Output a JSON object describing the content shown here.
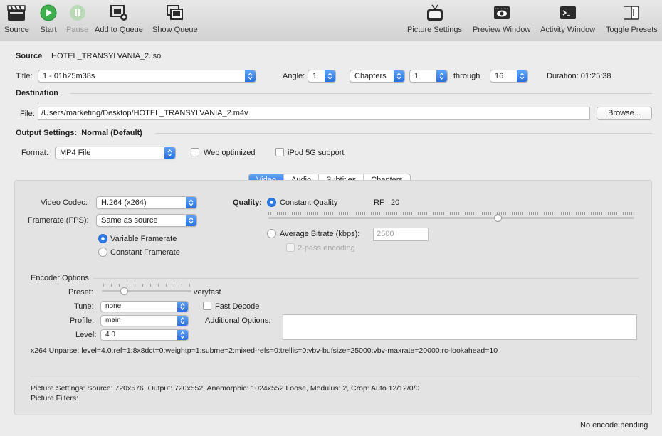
{
  "toolbar": {
    "source": "Source",
    "start": "Start",
    "pause": "Pause",
    "add_to_queue": "Add to Queue",
    "show_queue": "Show Queue",
    "picture_settings": "Picture Settings",
    "preview_window": "Preview Window",
    "activity_window": "Activity Window",
    "toggle_presets": "Toggle Presets"
  },
  "source": {
    "label": "Source",
    "name": "HOTEL_TRANSYLVANIA_2.iso",
    "title_label": "Title:",
    "title_value": "1 - 01h25m38s",
    "angle_label": "Angle:",
    "angle_value": "1",
    "range_mode": "Chapters",
    "range_start": "1",
    "through_label": "through",
    "range_end": "16",
    "duration_label": "Duration:",
    "duration_value": "01:25:38"
  },
  "destination": {
    "heading": "Destination",
    "file_label": "File:",
    "file_value": "/Users/marketing/Desktop/HOTEL_TRANSYLVANIA_2.m4v",
    "browse": "Browse..."
  },
  "output": {
    "heading": "Output Settings:",
    "preset": "Normal (Default)",
    "format_label": "Format:",
    "format_value": "MP4 File",
    "web_optimized": "Web optimized",
    "ipod_support": "iPod 5G support"
  },
  "tabs": [
    "Video",
    "Audio",
    "Subtitles",
    "Chapters"
  ],
  "video": {
    "codec_label": "Video Codec:",
    "codec_value": "H.264 (x264)",
    "framerate_label": "Framerate (FPS):",
    "framerate_value": "Same as source",
    "variable_framerate": "Variable Framerate",
    "constant_framerate": "Constant Framerate",
    "quality_label": "Quality:",
    "constant_quality": "Constant Quality",
    "rf_label": "RF",
    "rf_value": "20",
    "average_bitrate": "Average Bitrate (kbps):",
    "bitrate_value": "2500",
    "two_pass": "2-pass encoding"
  },
  "encoder": {
    "heading": "Encoder Options",
    "preset_label": "Preset:",
    "preset_value": "veryfast",
    "tune_label": "Tune:",
    "tune_value": "none",
    "fast_decode": "Fast Decode",
    "profile_label": "Profile:",
    "profile_value": "main",
    "additional_options": "Additional Options:",
    "level_label": "Level:",
    "level_value": "4.0",
    "unparse": "x264 Unparse: level=4.0:ref=1:8x8dct=0:weightp=1:subme=2:mixed-refs=0:trellis=0:vbv-bufsize=25000:vbv-maxrate=20000:rc-lookahead=10"
  },
  "picture": {
    "settings": "Picture Settings: Source: 720x576, Output: 720x552, Anamorphic: 1024x552 Loose, Modulus: 2, Crop: Auto 12/12/0/0",
    "filters": "Picture Filters:"
  },
  "status": "No encode pending",
  "colors": {
    "accent": "#2f7be6",
    "start_green": "#34a853"
  }
}
